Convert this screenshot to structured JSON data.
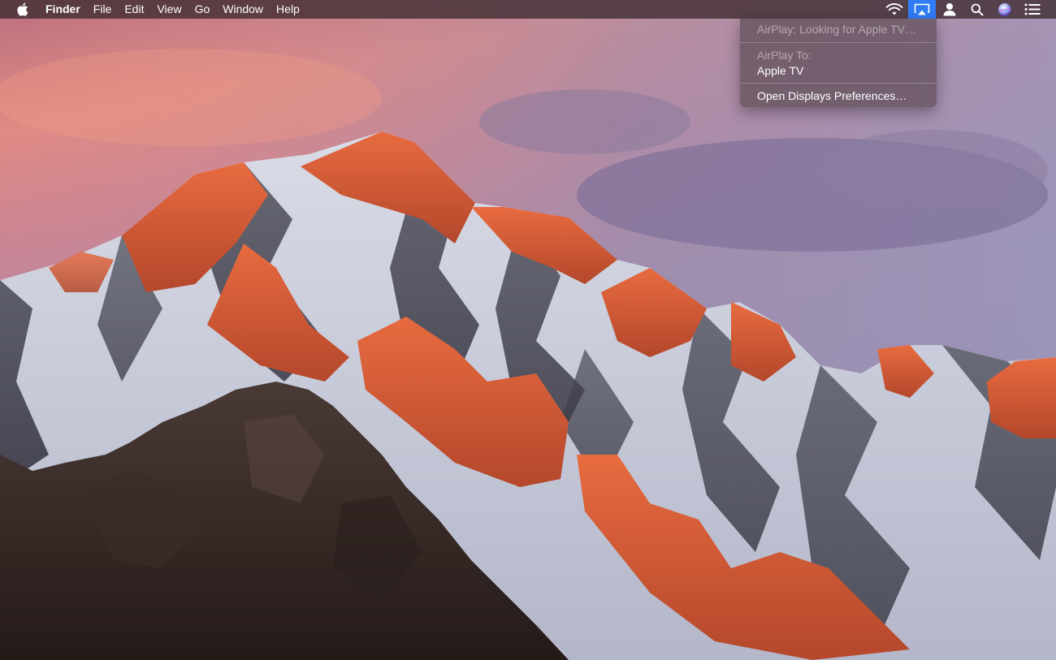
{
  "menubar": {
    "apple_icon": "apple-logo-icon",
    "app_name": "Finder",
    "menus": [
      "File",
      "Edit",
      "View",
      "Go",
      "Window",
      "Help"
    ],
    "status_icons": [
      "wifi-icon",
      "airplay-icon",
      "user-icon",
      "spotlight-search-icon",
      "siri-icon",
      "notification-center-icon"
    ],
    "active_status_icon": "airplay-icon"
  },
  "airplay_menu": {
    "status": "AirPlay: Looking for Apple TV…",
    "section_label": "AirPlay To:",
    "device": "Apple TV",
    "preferences": "Open Displays Preferences…"
  },
  "colors": {
    "menubar_background": "#3c2a30",
    "active_highlight": "#2f7cf6",
    "menu_text": "#ffffff"
  }
}
